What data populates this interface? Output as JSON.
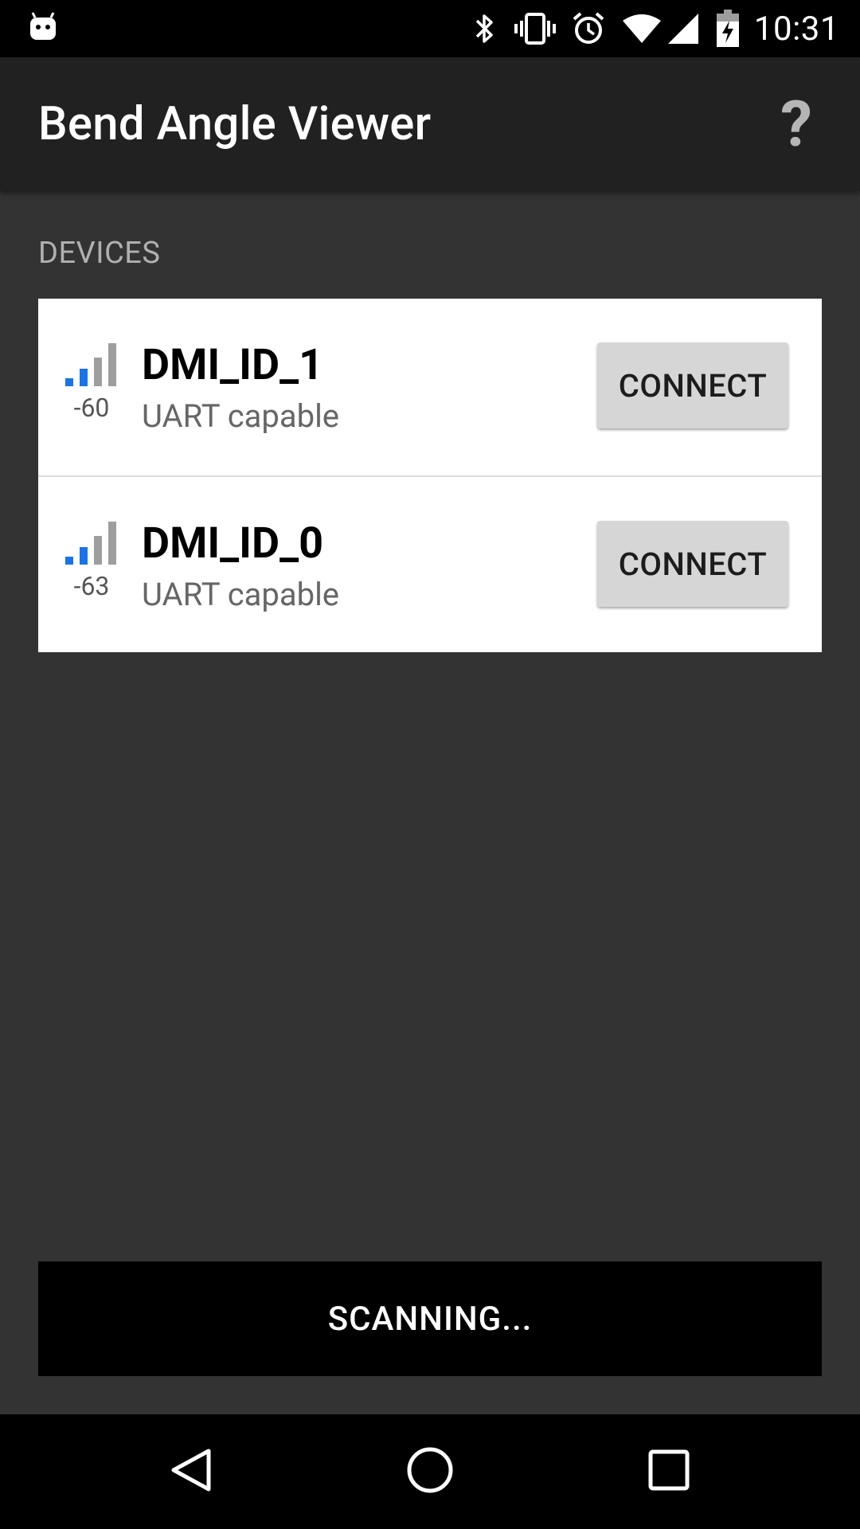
{
  "status_bar": {
    "time": "10:31",
    "icons": [
      "android-notification-icon",
      "bluetooth-icon",
      "vibrate-icon",
      "alarm-icon",
      "wifi-icon",
      "cell-signal-icon",
      "battery-charging-icon"
    ]
  },
  "app_bar": {
    "title": "Bend Angle Viewer",
    "help_label": "?"
  },
  "devices_section": {
    "label": "DEVICES",
    "items": [
      {
        "name": "DMI_ID_1",
        "subtitle": "UART capable",
        "rssi": "-60",
        "connect_label": "CONNECT",
        "signal_bars_active": 2,
        "signal_bars_total": 4
      },
      {
        "name": "DMI_ID_0",
        "subtitle": "UART capable",
        "rssi": "-63",
        "connect_label": "CONNECT",
        "signal_bars_active": 2,
        "signal_bars_total": 4
      }
    ]
  },
  "scan_button": {
    "label": "SCANNING..."
  },
  "nav_bar": {
    "buttons": [
      "back-icon",
      "home-icon",
      "recents-icon"
    ]
  },
  "colors": {
    "background": "#333333",
    "app_bar": "#212121",
    "signal_active": "#1a73e8",
    "signal_inactive": "#9e9e9e",
    "button_gray": "#d6d6d6"
  }
}
